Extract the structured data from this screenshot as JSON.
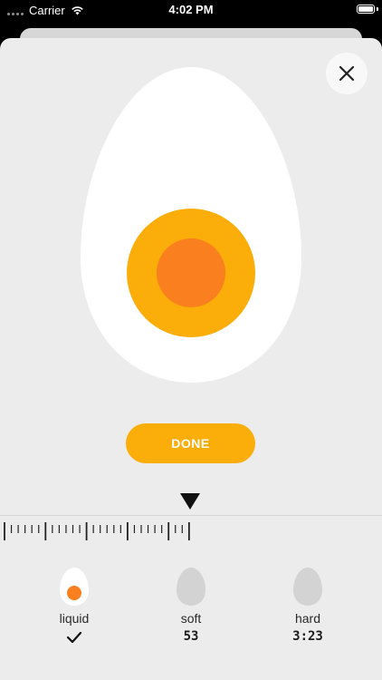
{
  "status_bar": {
    "carrier": "Carrier",
    "time": "4:02 PM",
    "battery_level": 1.0
  },
  "icons": {
    "close": "close-icon",
    "wifi": "wifi-icon",
    "battery": "battery-icon",
    "pointer": "triangle-pointer-icon",
    "check": "checkmark-icon"
  },
  "egg": {
    "white_color": "#ffffff",
    "yolk_outer_color": "#fbad0a",
    "yolk_inner_color": "#f97f1f"
  },
  "done_button": {
    "label": "DONE",
    "color": "#fbad0a"
  },
  "options": [
    {
      "label": "liquid",
      "value": "",
      "selected": true
    },
    {
      "label": "soft",
      "value": "53",
      "selected": false
    },
    {
      "label": "hard",
      "value": "3:23",
      "selected": false
    }
  ],
  "colors": {
    "sheet_background": "#ececec",
    "accent": "#fbad0a",
    "unselected_egg": "#d3d3d3"
  }
}
